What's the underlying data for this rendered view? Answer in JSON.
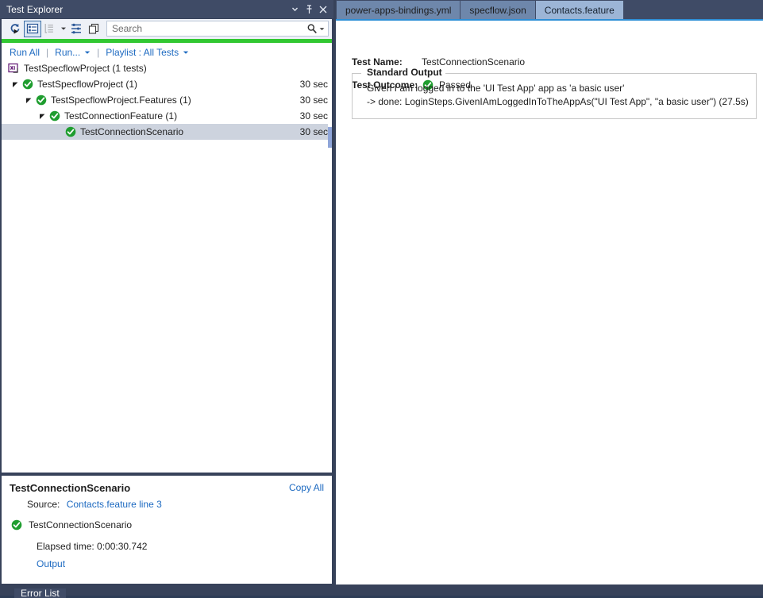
{
  "test_explorer": {
    "title": "Test Explorer",
    "window_buttons": [
      {
        "name": "dropdown",
        "glyph": "▾"
      },
      {
        "name": "pin",
        "glyph": "pin"
      },
      {
        "name": "close",
        "glyph": "✕"
      }
    ],
    "toolbar": {
      "run_tests_icon": "run-tests-icon",
      "list_view_icon": "list-view-icon",
      "group_by_icon": "group-by-icon",
      "group_by_caret": "▾",
      "expand_collapse_icon": "expand-collapse-icon",
      "copy_icon": "copy-icon",
      "search_placeholder": "Search",
      "search_value": "",
      "search_icon": "search-icon",
      "search_caret": "▾"
    },
    "progress": {
      "color": "#32c832",
      "percent": 100
    },
    "commands": {
      "run_all": "Run All",
      "run": "Run...",
      "run_caret": "▾",
      "playlist": "Playlist : All Tests",
      "playlist_caret": "▾",
      "separator": "|"
    },
    "tree": {
      "root": {
        "label": "TestSpecflowProject (1 tests)",
        "icon": "test-project-icon",
        "duration": ""
      },
      "rows": [
        {
          "label": "TestSpecflowProject (1)",
          "duration": "30 sec",
          "indent": 0,
          "expander": "expanded",
          "status": "passed",
          "selected": false
        },
        {
          "label": "TestSpecflowProject.Features (1)",
          "duration": "30 sec",
          "indent": 1,
          "expander": "expanded",
          "status": "passed",
          "selected": false
        },
        {
          "label": "TestConnectionFeature (1)",
          "duration": "30 sec",
          "indent": 2,
          "expander": "expanded",
          "status": "passed",
          "selected": false
        },
        {
          "label": "TestConnectionScenario",
          "duration": "30 sec",
          "indent": 3,
          "expander": "none",
          "status": "passed",
          "selected": true
        }
      ]
    },
    "details": {
      "title": "TestConnectionScenario",
      "copy_all": "Copy All",
      "source_label": "Source:",
      "source_link": "Contacts.feature line 3",
      "result_name": "TestConnectionScenario",
      "result_status": "passed",
      "elapsed": "Elapsed time: 0:00:30.742",
      "output_link": "Output"
    }
  },
  "document": {
    "tabs": [
      {
        "label": "power-apps-bindings.yml",
        "selected": false
      },
      {
        "label": "specflow.json",
        "selected": false
      },
      {
        "label": "Contacts.feature",
        "selected": true
      }
    ],
    "result": {
      "test_name_label": "Test Name:",
      "test_name_value": "TestConnectionScenario",
      "test_outcome_label": "Test Outcome:",
      "test_outcome_value": "Passed",
      "test_outcome_status": "passed",
      "standard_output_legend": "Standard Output",
      "standard_output_lines": [
        "Given I am logged in to the 'UI Test App' app as 'a basic user'",
        "-> done: LoginSteps.GivenIAmLoggedInToTheAppAs(\"UI Test App\", \"a basic user\") (27.5s)"
      ]
    }
  },
  "bottom_dock": {
    "tab_label": "Error List"
  },
  "colors": {
    "chrome": "#37425a",
    "title_bar": "#3f4b66",
    "accent_link": "#1d6ac1",
    "pass_green": "#1f9d2f",
    "progress_green": "#32c832",
    "tab_selected": "#9cb5d6",
    "tab_normal": "#6e87ab",
    "selection": "#cdd3de",
    "tab_accent": "#2e8fd6"
  }
}
